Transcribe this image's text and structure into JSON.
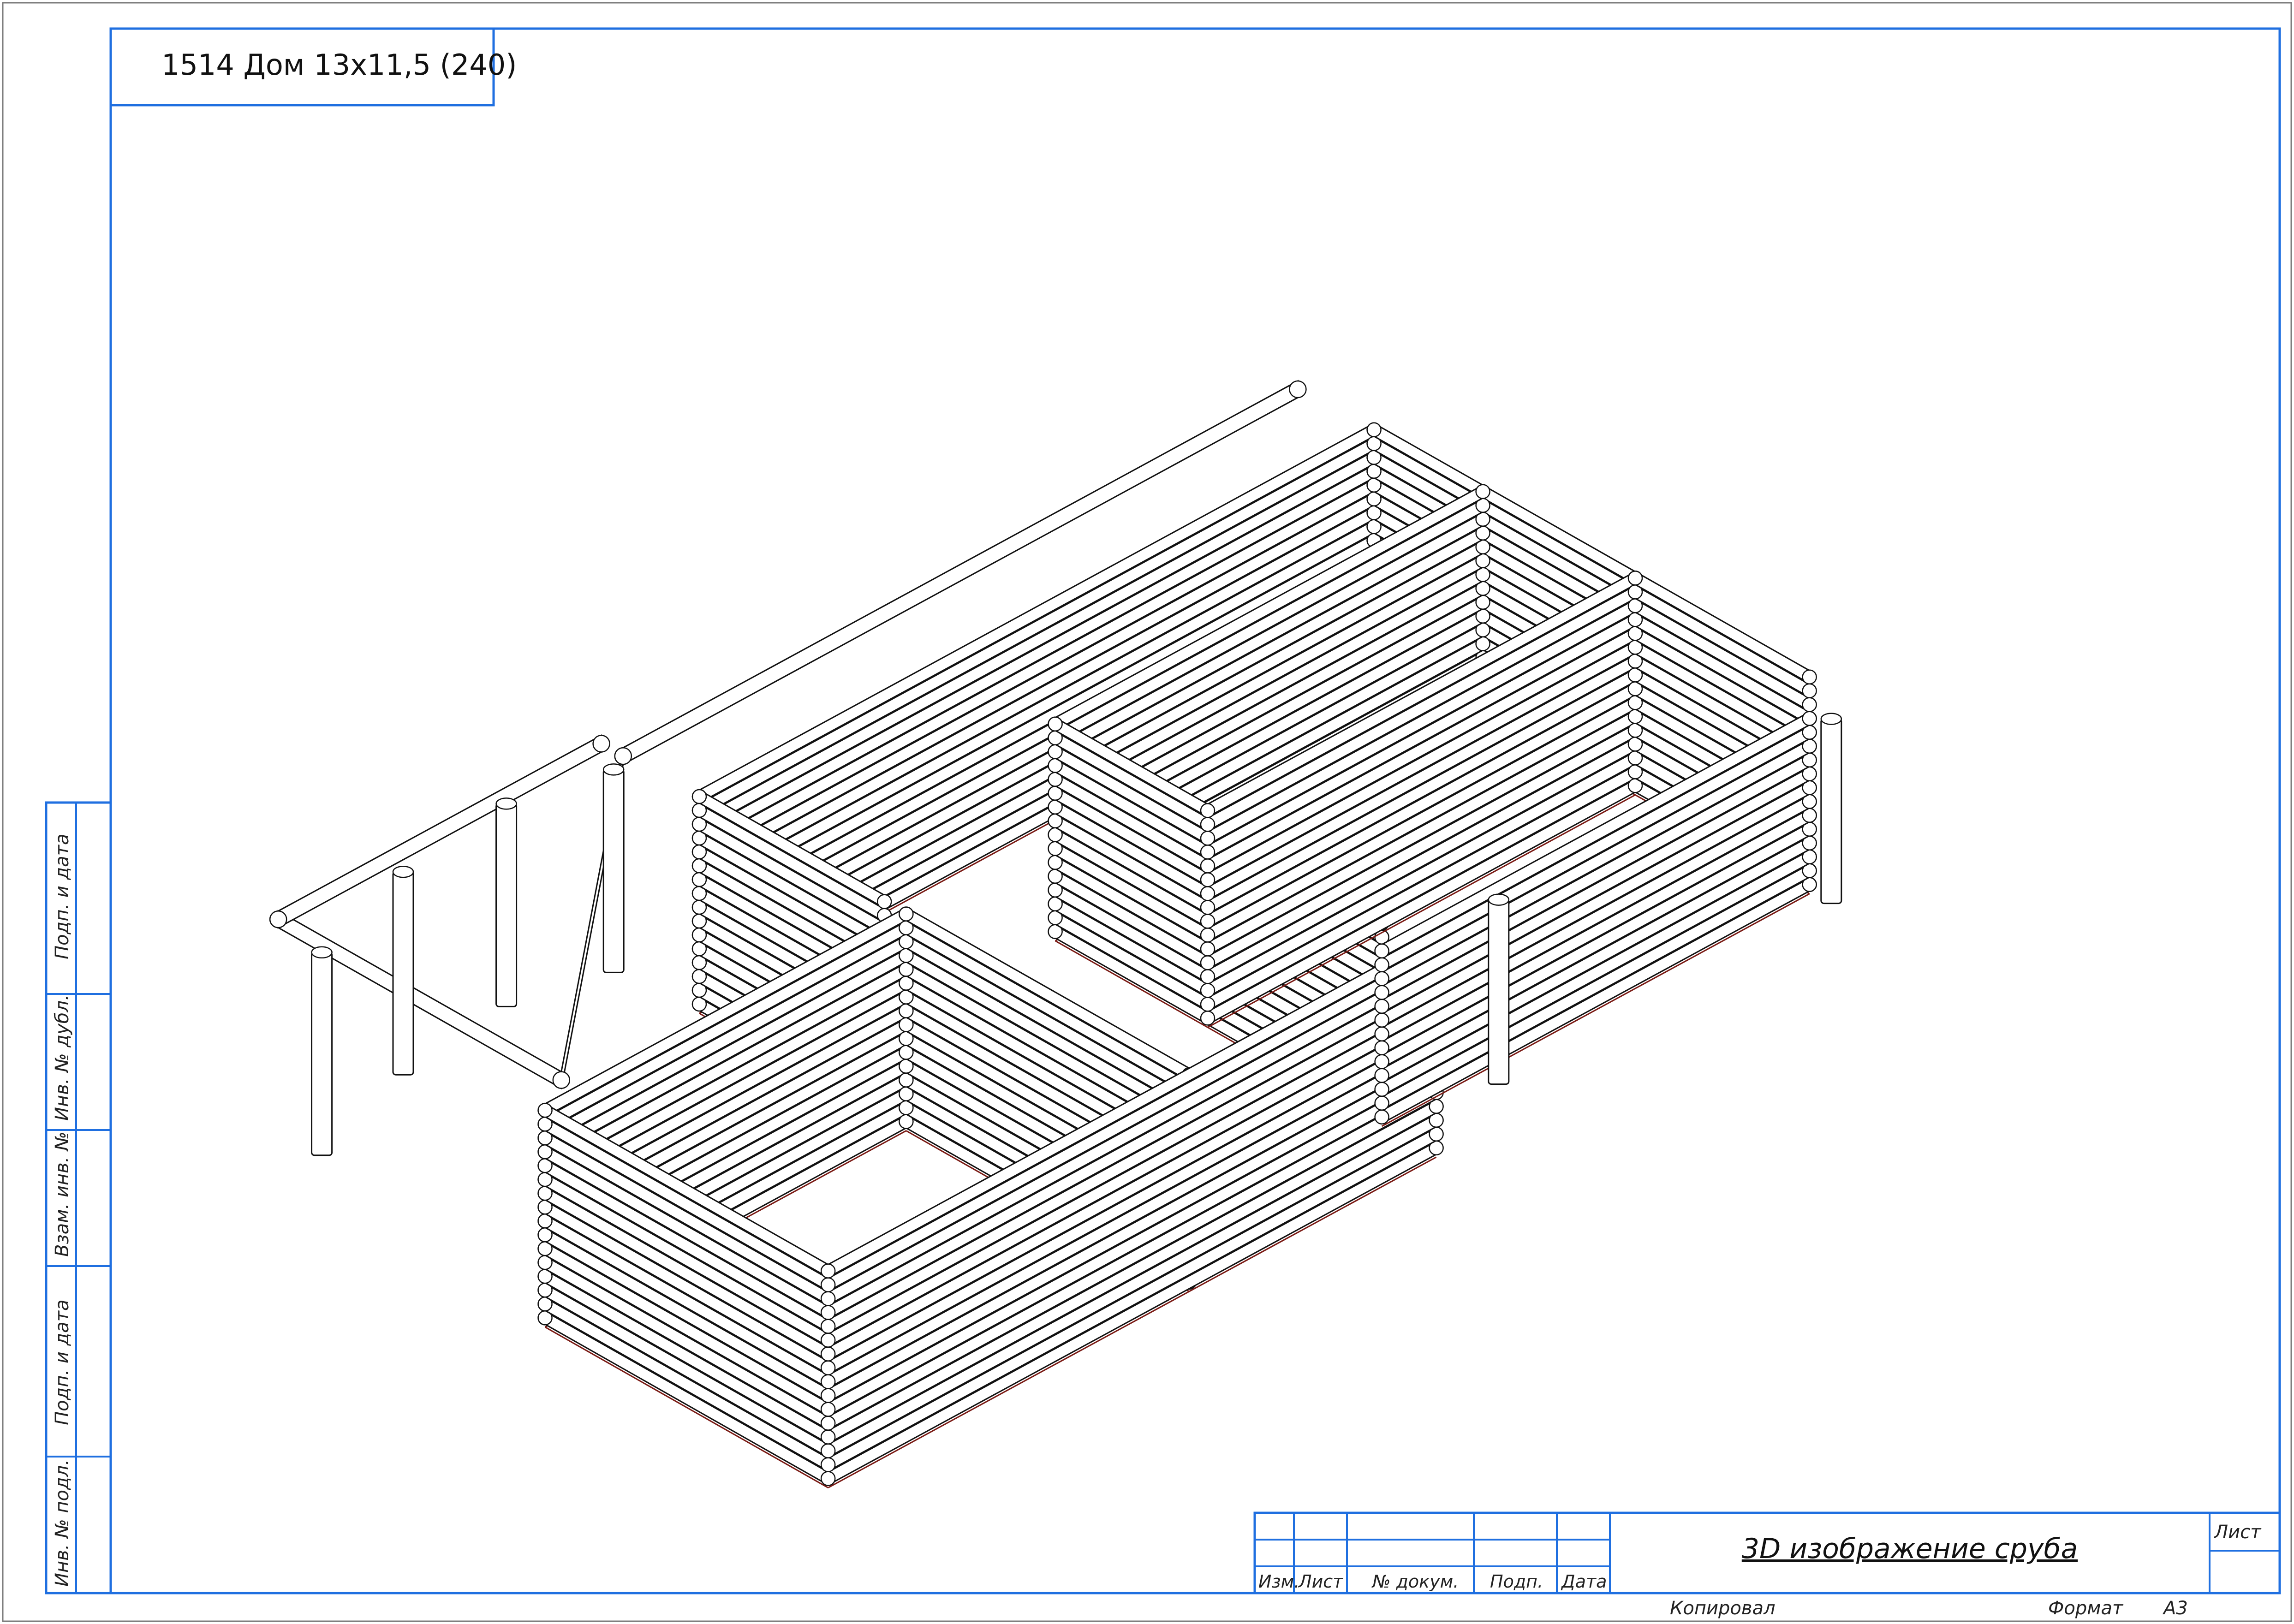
{
  "drawing": {
    "code_title": "1514  Дом 13х11,5 (240)",
    "sheet_name": "3D изображение сруба"
  },
  "side_stamp": {
    "cells": [
      "Подп. и дата",
      "Инв. № дубл.",
      "Взам. инв. №",
      "Подп. и дата",
      "Инв. № подл."
    ]
  },
  "title_block": {
    "headers": [
      "Изм.",
      "Лист",
      "№ докум.",
      "Подп.",
      "Дата"
    ],
    "sheet_label": "Лист"
  },
  "footer": {
    "copied": "Копировал",
    "format_label": "Формат",
    "format_value": "А3"
  },
  "colors": {
    "frame": "#1f6fe0",
    "lines": "#111111",
    "shadow": "#7a1a14"
  }
}
